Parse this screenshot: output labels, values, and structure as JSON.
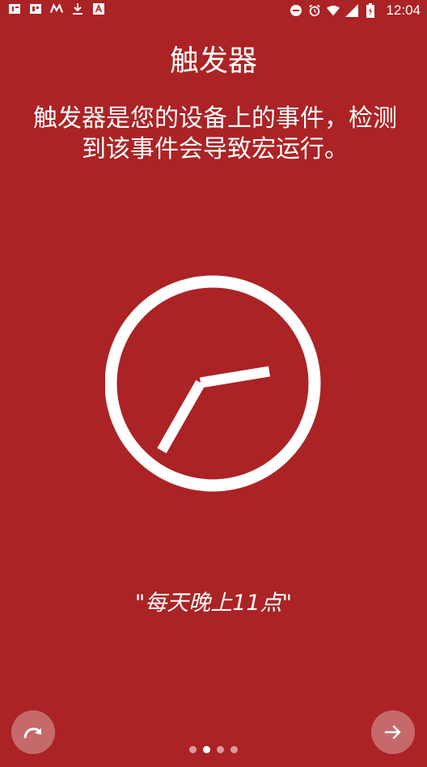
{
  "status_bar": {
    "time": "12:04",
    "left_icons": [
      "app-notification-icon",
      "app-notification-icon",
      "m-logo-icon",
      "download-icon",
      "a-app-icon"
    ],
    "right_icons": [
      "do-not-disturb-icon",
      "alarm-icon",
      "wifi-icon",
      "signal-icon",
      "battery-icon"
    ]
  },
  "page": {
    "title": "触发器",
    "description": "触发器是您的设备上的事件，检测到该事件会导致宏运行。",
    "example": "\"每天晚上11点\""
  },
  "pager": {
    "total_pages": 4,
    "current_page": 2
  },
  "buttons": {
    "skip_icon": "skip-icon",
    "next_icon": "arrow-right-icon"
  },
  "colors": {
    "background": "#ab2325",
    "foreground": "#ffffff"
  }
}
